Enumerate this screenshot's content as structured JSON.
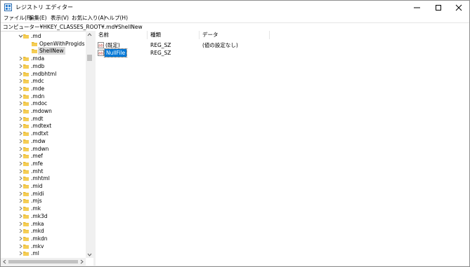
{
  "window": {
    "title": "レジストリ エディター",
    "app_icon": "registry-editor-icon"
  },
  "menu": [
    "ファイル(F)",
    "編集(E)",
    "表示(V)",
    "お気に入り(A)",
    "ヘルプ(H)"
  ],
  "address": "コンピューター¥HKEY_CLASSES_ROOT¥.md¥ShellNew",
  "tree": {
    "items": [
      {
        "label": ".md",
        "expanded": true
      },
      {
        "label": "OpenWithProgids",
        "child": true
      },
      {
        "label": "ShellNew",
        "child": true,
        "selected": true
      },
      {
        "label": ".mda"
      },
      {
        "label": ".mdb"
      },
      {
        "label": ".mdbhtml"
      },
      {
        "label": ".mdc"
      },
      {
        "label": ".mde"
      },
      {
        "label": ".mdn"
      },
      {
        "label": ".mdoc"
      },
      {
        "label": ".mdown"
      },
      {
        "label": ".mdt"
      },
      {
        "label": ".mdtext"
      },
      {
        "label": ".mdtxt"
      },
      {
        "label": ".mdw"
      },
      {
        "label": ".mdwn"
      },
      {
        "label": ".mef"
      },
      {
        "label": ".mfe"
      },
      {
        "label": ".mht"
      },
      {
        "label": ".mhtml"
      },
      {
        "label": ".mid"
      },
      {
        "label": ".midi"
      },
      {
        "label": ".mjs"
      },
      {
        "label": ".mk"
      },
      {
        "label": ".mk3d"
      },
      {
        "label": ".mka"
      },
      {
        "label": ".mkd"
      },
      {
        "label": ".mkdn"
      },
      {
        "label": ".mkv"
      },
      {
        "label": ".ml"
      }
    ]
  },
  "list": {
    "columns": [
      "名前",
      "種類",
      "データ"
    ],
    "rows": [
      {
        "name": "(既定)",
        "type": "REG_SZ",
        "data": "(値の設定なし)",
        "icon": "string-value-icon"
      },
      {
        "name": "NullFile",
        "type": "REG_SZ",
        "data": "",
        "icon": "string-value-icon",
        "selected": true
      }
    ]
  },
  "colors": {
    "selection": "#0078d7",
    "folder": "#e8b931",
    "tree_selected": "#d9d9d9"
  }
}
